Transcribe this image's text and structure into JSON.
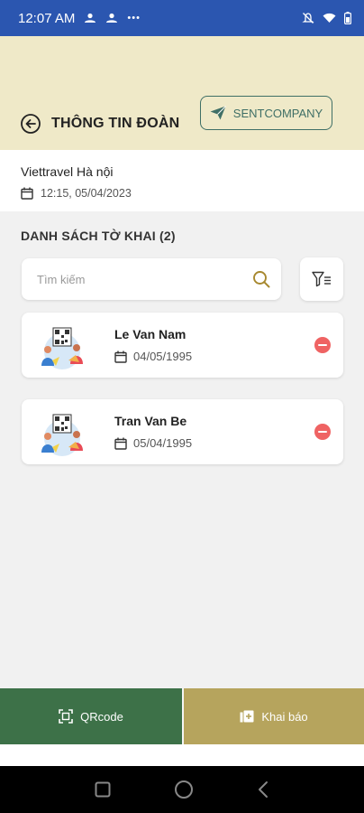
{
  "status_bar": {
    "time": "12:07 AM",
    "more": "•••"
  },
  "header": {
    "title": "THÔNG TIN ĐOÀN",
    "sent_button_label": "SENTCOMPANY"
  },
  "group": {
    "name": "Viettravel Hà nội",
    "datetime": "12:15, 05/04/2023"
  },
  "list": {
    "title": "DANH SÁCH TỜ KHAI (2)",
    "search_placeholder": "Tìm kiếm",
    "items": [
      {
        "name": "Le Van Nam",
        "dob": "04/05/1995"
      },
      {
        "name": "Tran Van Be",
        "dob": "05/04/1995"
      }
    ]
  },
  "bottom": {
    "qr_label": "QRcode",
    "declare_label": "Khai báo"
  },
  "colors": {
    "status_bar": "#2b56b0",
    "header_bg": "#efe9c8",
    "qr_button": "#3d7148",
    "declare_button": "#b6a45d",
    "remove": "#ef6363",
    "accent": "#3f6f66"
  }
}
